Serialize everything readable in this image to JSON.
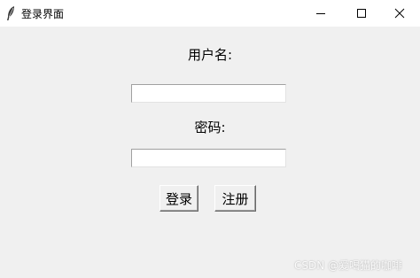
{
  "window": {
    "title": "登录界面",
    "icon": "feather-icon",
    "controls": {
      "minimize_icon": "minimize-icon",
      "maximize_icon": "maximize-icon",
      "close_icon": "close-icon"
    }
  },
  "form": {
    "username_label": "用户名:",
    "username_value": "",
    "password_label": "密码:",
    "password_value": "",
    "login_button": "登录",
    "register_button": "注册"
  },
  "watermark": "CSDN @爱喝猫的咖啡",
  "colors": {
    "window_bg": "#f0f0f0",
    "titlebar_bg": "#ffffff",
    "entry_bg": "#ffffff"
  }
}
